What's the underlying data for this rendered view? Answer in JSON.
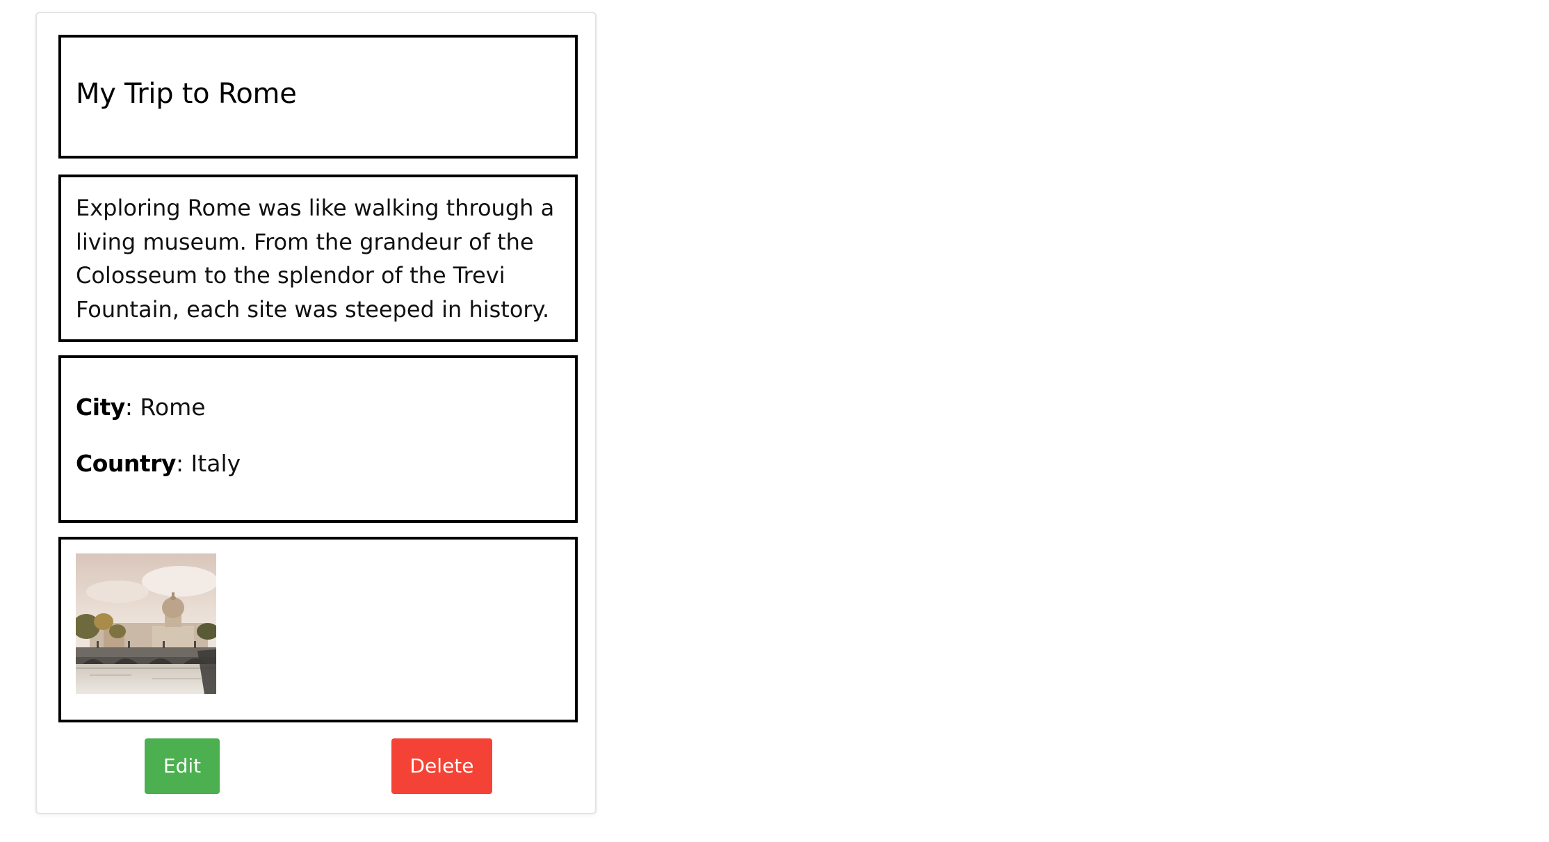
{
  "post": {
    "title": "My Trip to Rome",
    "description": "Exploring Rome was like walking through a living museum. From the grandeur of the Colosseum to the splendor of the Trevi Fountain, each site was steeped in history.",
    "city_label": "City",
    "city_value": ": Rome",
    "country_label": "Country",
    "country_value": ": Italy"
  },
  "actions": {
    "edit_label": "Edit",
    "delete_label": "Delete"
  },
  "colors": {
    "edit_button": "#4caf50",
    "delete_button": "#f44336",
    "section_border": "#000000"
  }
}
